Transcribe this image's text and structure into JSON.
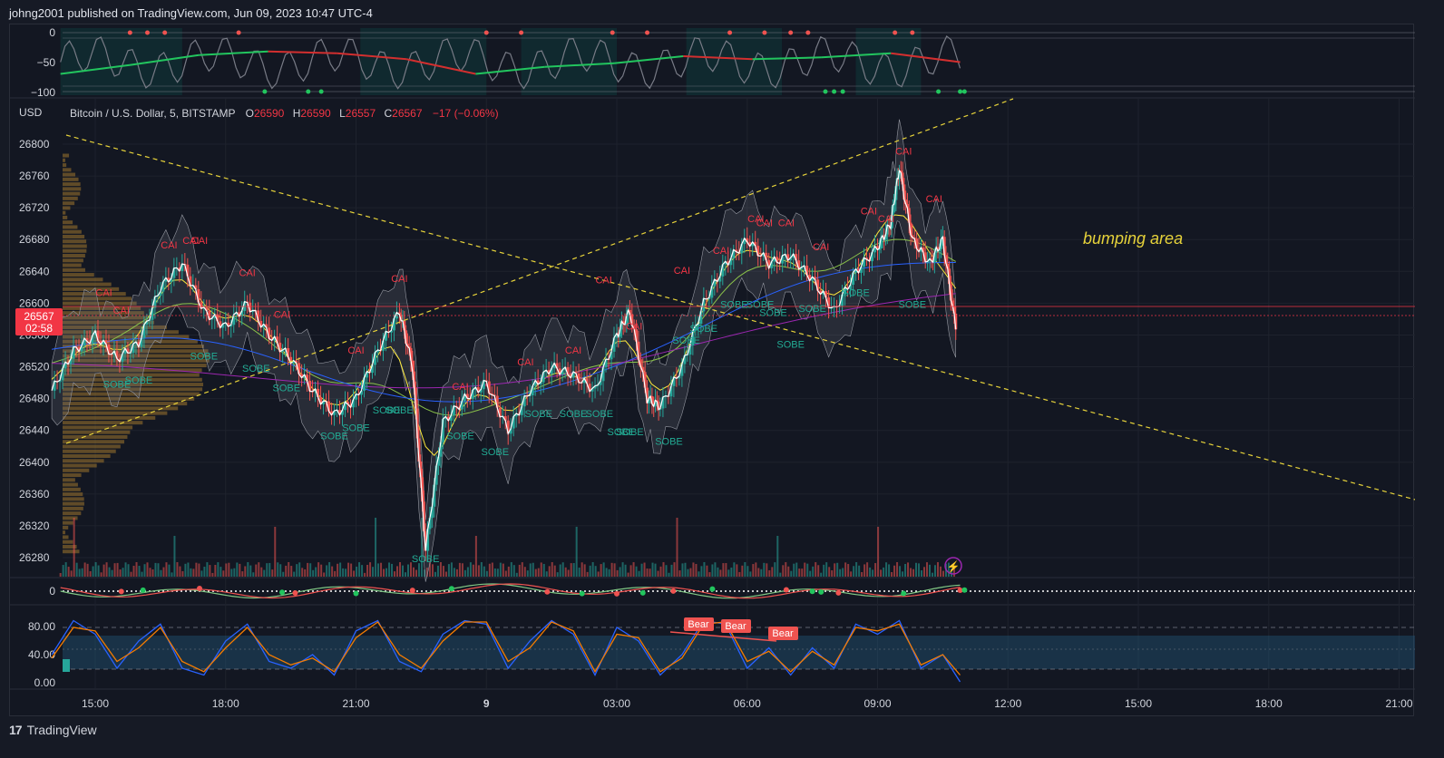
{
  "header": {
    "text": "johng2001 published on TradingView.com, Jun 09, 2023 10:47 UTC-4"
  },
  "footer": {
    "logo": "17",
    "brand": "TradingView"
  },
  "colors": {
    "background": "#131722",
    "up": "#26a69a",
    "down": "#ef5350",
    "grid": "#1e222d",
    "trendline": "#e6d23a",
    "label_red": "#f23645",
    "label_green": "#22ab94"
  },
  "chart_data": [
    {
      "type": "line",
      "panel": "oscillator",
      "y_ticks": [
        "0",
        "−50",
        "−100"
      ],
      "ylim": [
        -100,
        0
      ],
      "series": [
        {
          "color": "#22c55e/#d32f2f",
          "x": [
            0,
            10,
            20,
            30,
            40,
            50,
            60,
            70,
            80,
            90,
            100,
            110,
            120,
            130
          ],
          "values": [
            -70,
            -55,
            -38,
            -32,
            -35,
            -45,
            -70,
            -58,
            -52,
            -40,
            -45,
            -42,
            -35,
            -50
          ]
        }
      ]
    },
    {
      "type": "candlestick",
      "panel": "price",
      "title": "Bitcoin / U.S. Dollar, 5, BITSTAMP",
      "ohlc_text": {
        "o_label": "O",
        "o": "26590",
        "h_label": "H",
        "h": "26590",
        "l_label": "L",
        "l": "26557",
        "c_label": "C",
        "c": "26567",
        "change": "−17 (−0.06%)"
      },
      "currency": "USD",
      "y_ticks": [
        "26800",
        "26760",
        "26720",
        "26680",
        "26640",
        "26600",
        "26560",
        "26520",
        "26480",
        "26440",
        "26400",
        "26360",
        "26320",
        "26280"
      ],
      "ylim": [
        26250,
        26820
      ],
      "last_price": "26567",
      "countdown": "02:58",
      "annotation": "bumping area",
      "x_ticks": [
        "15:00",
        "18:00",
        "21:00",
        "9",
        "03:00",
        "06:00",
        "09:00",
        "12:00",
        "15:00",
        "18:00",
        "21:00"
      ],
      "close_path": [
        [
          14.0,
          26490
        ],
        [
          14.5,
          26540
        ],
        [
          15.0,
          26560
        ],
        [
          15.5,
          26530
        ],
        [
          16.0,
          26550
        ],
        [
          16.5,
          26620
        ],
        [
          17.0,
          26650
        ],
        [
          17.5,
          26590
        ],
        [
          18.0,
          26570
        ],
        [
          18.5,
          26600
        ],
        [
          19.0,
          26560
        ],
        [
          19.5,
          26530
        ],
        [
          20.0,
          26490
        ],
        [
          20.5,
          26460
        ],
        [
          21.0,
          26480
        ],
        [
          21.5,
          26540
        ],
        [
          22.0,
          26590
        ],
        [
          22.3,
          26520
        ],
        [
          22.6,
          26290
        ],
        [
          23.0,
          26450
        ],
        [
          23.5,
          26480
        ],
        [
          24.0,
          26500
        ],
        [
          24.5,
          26440
        ],
        [
          25.0,
          26490
        ],
        [
          25.5,
          26520
        ],
        [
          26.0,
          26510
        ],
        [
          26.5,
          26490
        ],
        [
          27.0,
          26560
        ],
        [
          27.3,
          26590
        ],
        [
          27.7,
          26480
        ],
        [
          28.0,
          26470
        ],
        [
          28.5,
          26520
        ],
        [
          29.0,
          26600
        ],
        [
          29.5,
          26650
        ],
        [
          30.0,
          26680
        ],
        [
          30.5,
          26650
        ],
        [
          31.0,
          26660
        ],
        [
          31.5,
          26630
        ],
        [
          32.0,
          26590
        ],
        [
          32.5,
          26640
        ],
        [
          33.0,
          26670
        ],
        [
          33.3,
          26700
        ],
        [
          33.5,
          26770
        ],
        [
          33.8,
          26680
        ],
        [
          34.2,
          26650
        ],
        [
          34.5,
          26680
        ],
        [
          34.8,
          26567
        ]
      ],
      "cai_labels": [
        "CAI",
        "CAI",
        "CAI",
        "CAI",
        "CAI",
        "CAI",
        "CAI",
        "CAI",
        "CAI",
        "CAI",
        "CAI",
        "CAI",
        "CAI",
        "CAI",
        "CAI",
        "CAI",
        "CAI",
        "CAI",
        "CAI",
        "CAI",
        "CAI",
        "CAI",
        "CAI",
        "CAI"
      ],
      "sobe_labels": [
        "SOBE",
        "SOBE",
        "SOBE",
        "SOBE",
        "SOBE",
        "SOBE",
        "SOBE",
        "SOBE",
        "SOBE",
        "SOBE",
        "SOBE",
        "SOBE",
        "SOBE",
        "SOBE",
        "SOBE",
        "SOBE",
        "SOBE",
        "SOBE",
        "SOBE",
        "SOBE",
        "SOBE",
        "SOBE",
        "SOBE",
        "SOBE",
        "SOBE",
        "SOBE",
        "SOBE"
      ]
    },
    {
      "type": "line",
      "panel": "macd",
      "y_ticks": [
        "0"
      ]
    },
    {
      "type": "line",
      "panel": "stochastic",
      "y_ticks": [
        "80.00",
        "40.00",
        "0.00"
      ],
      "ylim": [
        0,
        100
      ],
      "bear_labels": [
        "Bear",
        "Bear",
        "Bear"
      ],
      "series": [
        {
          "name": "",
          "color": "#2962ff",
          "x": [
            14.0,
            14.5,
            15.0,
            15.5,
            16.0,
            16.5,
            17.0,
            17.5,
            18.0,
            18.5,
            19.0,
            19.5,
            20.0,
            20.5,
            21.0,
            21.5,
            22.0,
            22.5,
            23.0,
            23.5,
            24.0,
            24.5,
            25.0,
            25.5,
            26.0,
            26.5,
            27.0,
            27.5,
            28.0,
            28.5,
            29.0,
            29.5,
            30.0,
            30.5,
            31.0,
            31.5,
            32.0,
            32.5,
            33.0,
            33.5,
            34.0,
            34.5,
            34.9
          ],
          "values": [
            40,
            90,
            70,
            20,
            60,
            85,
            20,
            10,
            60,
            85,
            30,
            20,
            40,
            10,
            75,
            90,
            30,
            15,
            70,
            90,
            85,
            20,
            60,
            90,
            70,
            10,
            80,
            60,
            10,
            40,
            90,
            85,
            20,
            50,
            10,
            50,
            20,
            85,
            70,
            90,
            20,
            40,
            0
          ]
        },
        {
          "name": "",
          "color": "#f57c00",
          "x": [
            14.0,
            14.5,
            15.0,
            15.5,
            16.0,
            16.5,
            17.0,
            17.5,
            18.0,
            18.5,
            19.0,
            19.5,
            20.0,
            20.5,
            21.0,
            21.5,
            22.0,
            22.5,
            23.0,
            23.5,
            24.0,
            24.5,
            25.0,
            25.5,
            26.0,
            26.5,
            27.0,
            27.5,
            28.0,
            28.5,
            29.0,
            29.5,
            30.0,
            30.5,
            31.0,
            31.5,
            32.0,
            32.5,
            33.0,
            33.5,
            34.0,
            34.5,
            34.9
          ],
          "values": [
            35,
            80,
            75,
            30,
            50,
            80,
            30,
            15,
            50,
            80,
            40,
            25,
            35,
            15,
            65,
            88,
            40,
            20,
            60,
            88,
            88,
            30,
            50,
            88,
            75,
            15,
            70,
            65,
            15,
            35,
            85,
            88,
            30,
            45,
            15,
            45,
            25,
            80,
            75,
            85,
            25,
            40,
            10
          ]
        }
      ]
    }
  ]
}
